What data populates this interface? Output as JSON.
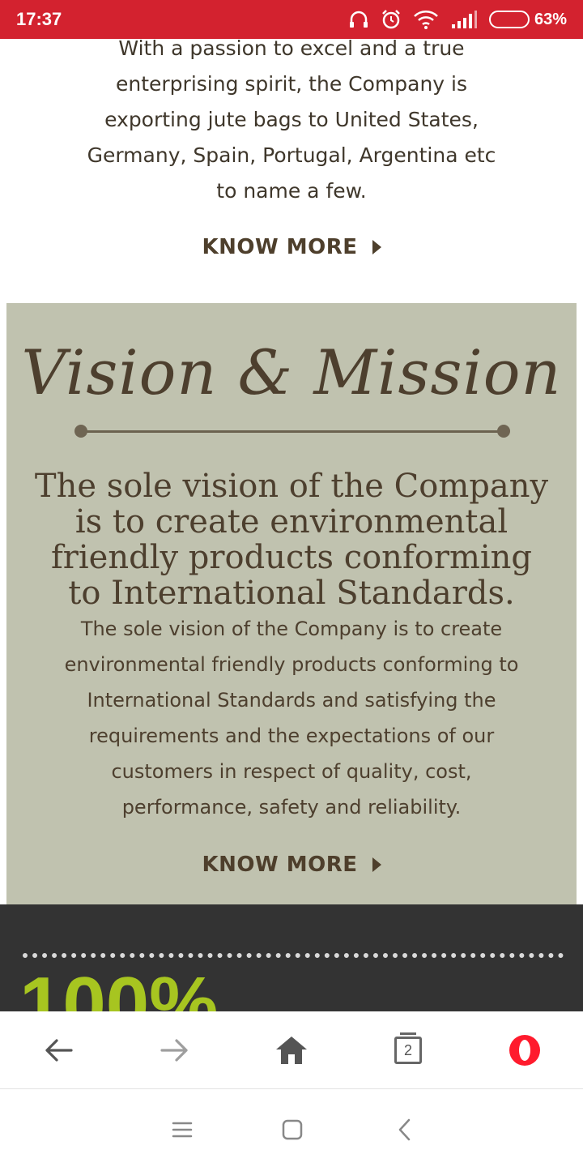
{
  "status_bar": {
    "time": "17:37",
    "battery_percent": "63%",
    "battery_level": 0.63,
    "icons": [
      "headset-icon",
      "alarm-icon",
      "wifi-icon",
      "signal-icon",
      "battery-icon"
    ]
  },
  "intro": {
    "lines": [
      "With a passion to excel and a true",
      "enterprising spirit, the Company is",
      "exporting jute bags to United States,",
      "Germany, Spain, Portugal, Argentina etc",
      "to name a few."
    ],
    "know_more_label": "KNOW MORE"
  },
  "vision": {
    "title": "Vision & Mission",
    "heading_lines": [
      "The sole vision of the Company",
      "is to create environmental",
      "friendly products conforming",
      "to International Standards."
    ],
    "body_lines": [
      "The sole vision of the Company is to create",
      "environmental friendly products conforming to",
      "International Standards and satisfying the",
      "requirements and the expectations of our",
      "customers in respect of quality, cost,",
      "performance, safety and reliability."
    ],
    "know_more_label": "KNOW MORE"
  },
  "stats": {
    "number": "100%",
    "accent_color": "#a7c520"
  },
  "browser_bar": {
    "tab_count": "2",
    "icons": [
      "back-arrow-icon",
      "forward-arrow-icon",
      "home-icon",
      "tabs-icon",
      "opera-icon"
    ]
  },
  "nav_bar": {
    "icons": [
      "menu-icon",
      "home-square-icon",
      "back-chevron-icon"
    ]
  },
  "colors": {
    "status_bar": "#d3222f",
    "panel": "#c0c2af",
    "text_brown": "#4d3f2e",
    "dark_section": "#333333"
  }
}
